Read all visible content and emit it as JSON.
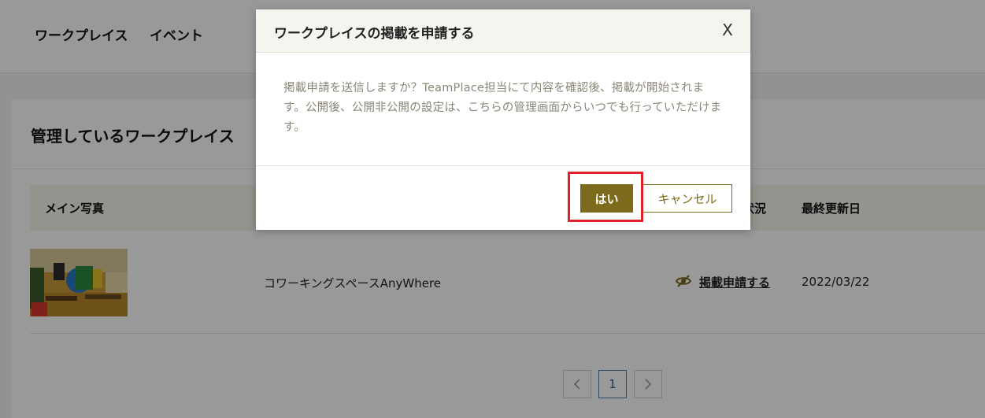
{
  "nav": {
    "workplace": "ワークプレイス",
    "event": "イベント"
  },
  "card": {
    "title": "管理しているワークプレイス"
  },
  "table": {
    "columns": {
      "main_photo": "メイン写真",
      "status": "状況",
      "updated": "最終更新日"
    },
    "rows": [
      {
        "name": "コワーキングスペースAnyWhere",
        "status_action": "掲載申請する",
        "updated": "2022/03/22",
        "status_icon": "eye-slash-icon"
      }
    ]
  },
  "pagination": {
    "prev_icon": "chevron-left-icon",
    "current": "1",
    "next_icon": "chevron-right-icon"
  },
  "modal": {
    "title": "ワークプレイスの掲載を申請する",
    "close": "X",
    "message": "掲載申請を送信しますか？TeamPlace担当にて内容を確認後、掲載が開始されます。公開後、公開非公開の設定は、こちらの管理画面からいつでも行っていただけます。",
    "yes_label": "はい",
    "cancel_label": "キャンセル"
  },
  "colors": {
    "primary": "#7c6a1d",
    "highlight": "#e0202a",
    "table_header_bg": "#f7f5ec",
    "modal_header_bg": "#f5f4ef"
  }
}
